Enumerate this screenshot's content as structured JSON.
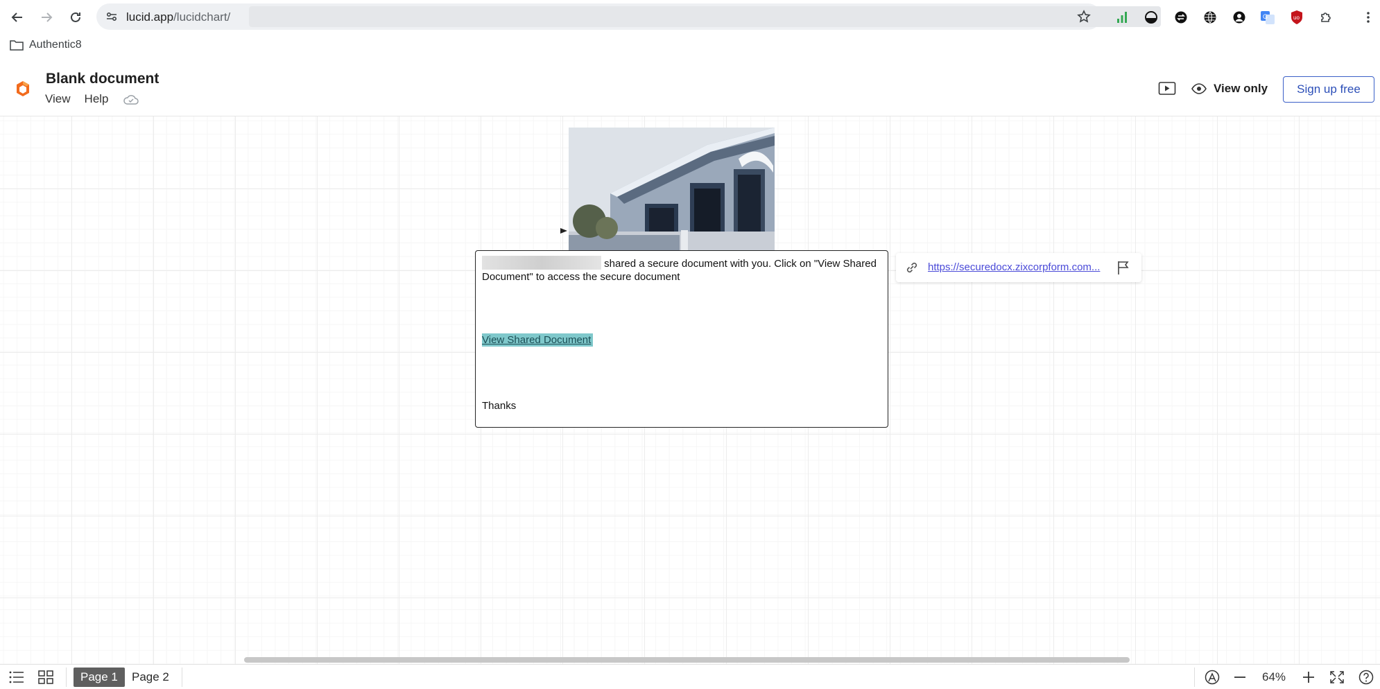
{
  "browser": {
    "url_host": "lucid.app",
    "url_path": "/lucidchart/",
    "bookmark_label": "Authentic8"
  },
  "header": {
    "title": "Blank document",
    "menu": [
      "View",
      "Help"
    ],
    "view_only_label": "View only",
    "signup_label": "Sign up free"
  },
  "canvas": {
    "email": {
      "text": "shared a secure document with you. Click on \"View Shared Document\" to access the secure document",
      "cta": "View Shared Document",
      "closing": "Thanks"
    },
    "link_popup": {
      "url": "https://securedocx.zixcorpform.com..."
    }
  },
  "footer": {
    "pages": [
      "Page 1",
      "Page 2"
    ],
    "zoom": "64%"
  },
  "colors": {
    "accent": "#2c4fb8",
    "cta_highlight": "#7fc8cb",
    "logo_orange": "#f26b1d"
  },
  "icons": [
    "back-icon",
    "forward-icon",
    "reload-icon",
    "site-info-icon",
    "star-icon",
    "folder-icon",
    "lucid-logo-icon",
    "cloud-icon",
    "present-icon",
    "eye-icon",
    "link-icon",
    "flag-icon",
    "list-icon",
    "grid-icon",
    "accessibility-icon",
    "zoom-out-icon",
    "zoom-in-icon",
    "fullscreen-icon",
    "help-icon"
  ]
}
